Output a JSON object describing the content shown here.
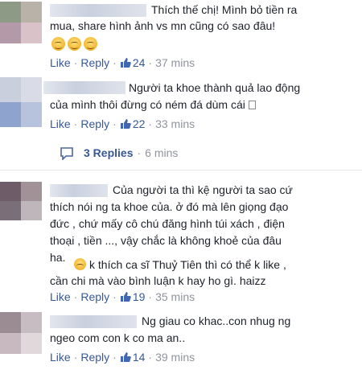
{
  "comments": [
    {
      "text_lines": [
        "Thích thế chị! Mình bỏ tiền ra",
        "mua, share hình ảnh vs mn cũng có sao đâu!"
      ],
      "like_label": "Like",
      "reply_label": "Reply",
      "likes": "24",
      "time": "37 mins",
      "emoji": [
        "smile-emoji",
        "smile-emoji",
        "smile-emoji"
      ]
    },
    {
      "text_lines": [
        "Người ta khoe thành quả lao động",
        "của mình thôi đừng có ném đá dùm cái"
      ],
      "like_label": "Like",
      "reply_label": "Reply",
      "likes": "22",
      "time": "33 mins",
      "replies": "3 Replies",
      "replies_time": "6 mins"
    },
    {
      "text_lines": [
        "Của người ta thì kệ người ta sao cứ",
        "thích nói ng ta khoe của. ở đó mà lên giọng đạo",
        "đức , chứ mấy cô chú đăng hình túi xách , điện",
        "thoại , tiền ..., vậy chắc là không khoẻ của đâu",
        "ha.",
        "k thích ca sĩ Thuỷ Tiên thì có thể k like ,",
        "cần chi mà vào bình luận k hay ho gì. haizz"
      ],
      "like_label": "Like",
      "reply_label": "Reply",
      "likes": "19",
      "time": "35 mins"
    },
    {
      "text_lines": [
        "Ng giau co khac..con nhug ng",
        "ngeo com con k co ma an.."
      ],
      "like_label": "Like",
      "reply_label": "Reply",
      "likes": "14",
      "time": "39 mins"
    }
  ],
  "colors": {
    "link": "#365899",
    "meta": "#90949c",
    "text": "#1d2129"
  }
}
